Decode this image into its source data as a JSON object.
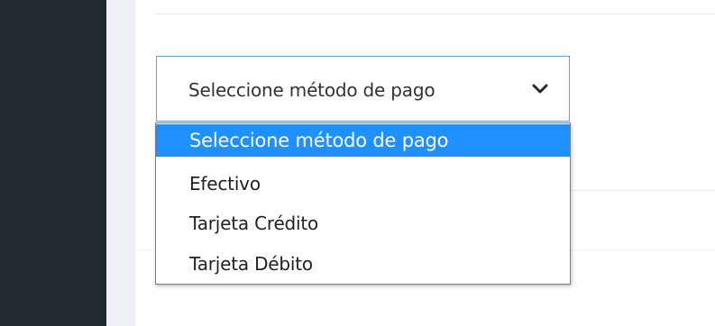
{
  "payment": {
    "selected_value": "Seleccione método de pago",
    "chevron_icon": "chevron-down-icon",
    "options": [
      "Seleccione método de pago",
      "Efectivo",
      "Tarjeta Crédito",
      "Tarjeta Débito"
    ]
  },
  "colors": {
    "sidebar": "#222b2f",
    "gutter": "#edf0f4",
    "highlight": "#1e90ff",
    "select_border": "#6aa3cf"
  }
}
